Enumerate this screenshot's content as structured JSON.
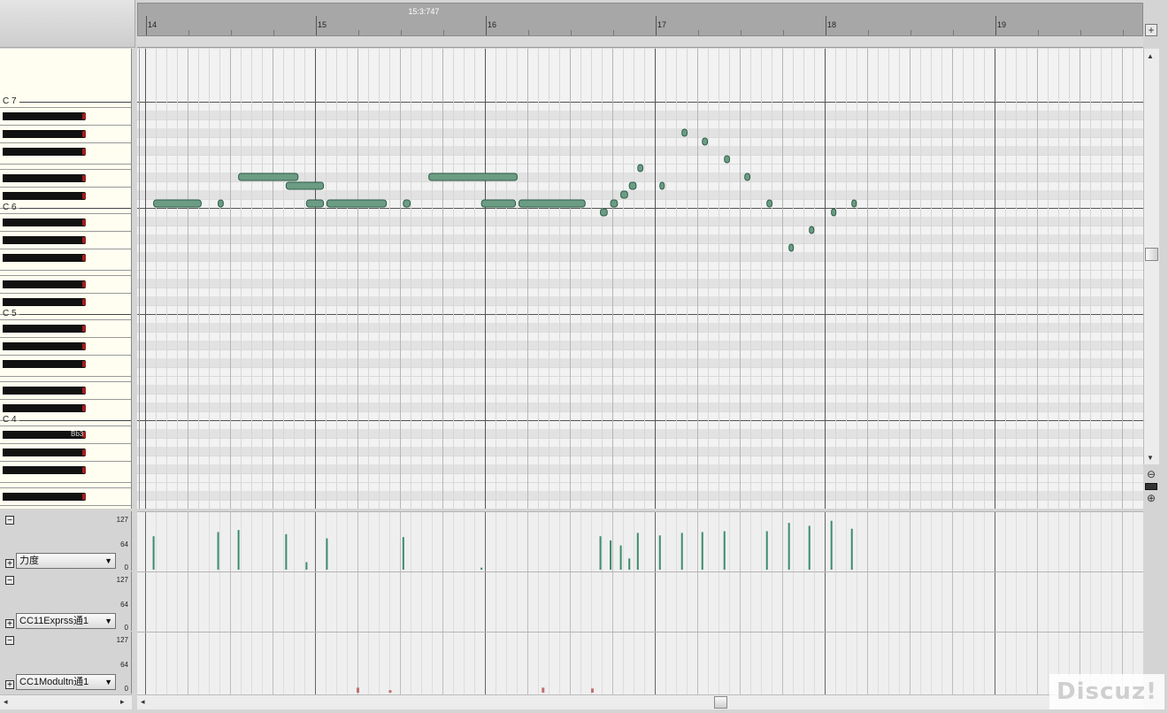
{
  "timeline": {
    "cursor_time": "15:3:747",
    "measures": [
      "14",
      "15",
      "16",
      "17",
      "18",
      "19"
    ]
  },
  "piano": {
    "octave_labels": [
      "C 7",
      "C 6",
      "C 5",
      "C 4"
    ],
    "hover_key_label": "Bb3"
  },
  "cc_lanes": [
    {
      "name": "力度",
      "max": "127",
      "mid": "64",
      "min": "0"
    },
    {
      "name": "CC11Exprss通1",
      "max": "127",
      "mid": "64",
      "min": "0"
    },
    {
      "name": "CC1Modultn通1",
      "max": "127",
      "mid": "64",
      "min": "0"
    }
  ],
  "buttons": {
    "expand": "+",
    "collapse": "−",
    "add": "+"
  },
  "watermark": "Discuz!",
  "icons": {
    "zoom_in": "zoom-in-icon",
    "zoom_out": "zoom-out-icon"
  },
  "colors": {
    "note_fill": "#6c9c84",
    "note_stroke": "#2e5e48",
    "velocity": "#3c8c6c",
    "cc_point": "#c07070"
  },
  "notes": [
    {
      "start": 14.05,
      "end": 14.33,
      "pitch": 84
    },
    {
      "start": 14.43,
      "end": 14.46,
      "pitch": 84
    },
    {
      "start": 14.55,
      "end": 14.9,
      "pitch": 87
    },
    {
      "start": 14.83,
      "end": 15.05,
      "pitch": 86
    },
    {
      "start": 14.95,
      "end": 15.05,
      "pitch": 84
    },
    {
      "start": 15.07,
      "end": 15.42,
      "pitch": 84
    },
    {
      "start": 15.52,
      "end": 15.56,
      "pitch": 84
    },
    {
      "start": 15.67,
      "end": 16.19,
      "pitch": 87
    },
    {
      "start": 15.98,
      "end": 16.18,
      "pitch": 84
    },
    {
      "start": 16.2,
      "end": 16.59,
      "pitch": 84
    },
    {
      "start": 16.68,
      "end": 16.72,
      "pitch": 83
    },
    {
      "start": 16.74,
      "end": 16.78,
      "pitch": 84
    },
    {
      "start": 16.8,
      "end": 16.84,
      "pitch": 85
    },
    {
      "start": 16.85,
      "end": 16.89,
      "pitch": 86
    },
    {
      "start": 16.9,
      "end": 16.93,
      "pitch": 88
    },
    {
      "start": 17.03,
      "end": 17.05,
      "pitch": 86
    },
    {
      "start": 17.16,
      "end": 17.19,
      "pitch": 92
    },
    {
      "start": 17.28,
      "end": 17.31,
      "pitch": 91
    },
    {
      "start": 17.41,
      "end": 17.44,
      "pitch": 89
    },
    {
      "start": 17.53,
      "end": 17.56,
      "pitch": 87
    },
    {
      "start": 17.66,
      "end": 17.69,
      "pitch": 84
    },
    {
      "start": 17.79,
      "end": 17.81,
      "pitch": 79
    },
    {
      "start": 17.91,
      "end": 17.93,
      "pitch": 81
    },
    {
      "start": 18.04,
      "end": 18.06,
      "pitch": 83
    },
    {
      "start": 18.16,
      "end": 18.18,
      "pitch": 84
    }
  ],
  "velocities": [
    {
      "t": 14.05,
      "v": 80
    },
    {
      "t": 14.43,
      "v": 90
    },
    {
      "t": 14.55,
      "v": 95
    },
    {
      "t": 14.83,
      "v": 85
    },
    {
      "t": 14.95,
      "v": 18
    },
    {
      "t": 15.07,
      "v": 75
    },
    {
      "t": 15.52,
      "v": 78
    },
    {
      "t": 15.98,
      "v": 5
    },
    {
      "t": 16.68,
      "v": 80
    },
    {
      "t": 16.74,
      "v": 70
    },
    {
      "t": 16.8,
      "v": 58
    },
    {
      "t": 16.85,
      "v": 27
    },
    {
      "t": 16.9,
      "v": 88
    },
    {
      "t": 17.03,
      "v": 82
    },
    {
      "t": 17.16,
      "v": 88
    },
    {
      "t": 17.28,
      "v": 90
    },
    {
      "t": 17.41,
      "v": 92
    },
    {
      "t": 17.66,
      "v": 92
    },
    {
      "t": 17.79,
      "v": 112
    },
    {
      "t": 17.91,
      "v": 105
    },
    {
      "t": 18.04,
      "v": 117
    },
    {
      "t": 18.16,
      "v": 98
    }
  ],
  "cc1_points": [
    {
      "t": 15.25,
      "v": 12
    },
    {
      "t": 15.44,
      "v": 6
    },
    {
      "t": 16.34,
      "v": 12
    },
    {
      "t": 16.63,
      "v": 10
    }
  ]
}
